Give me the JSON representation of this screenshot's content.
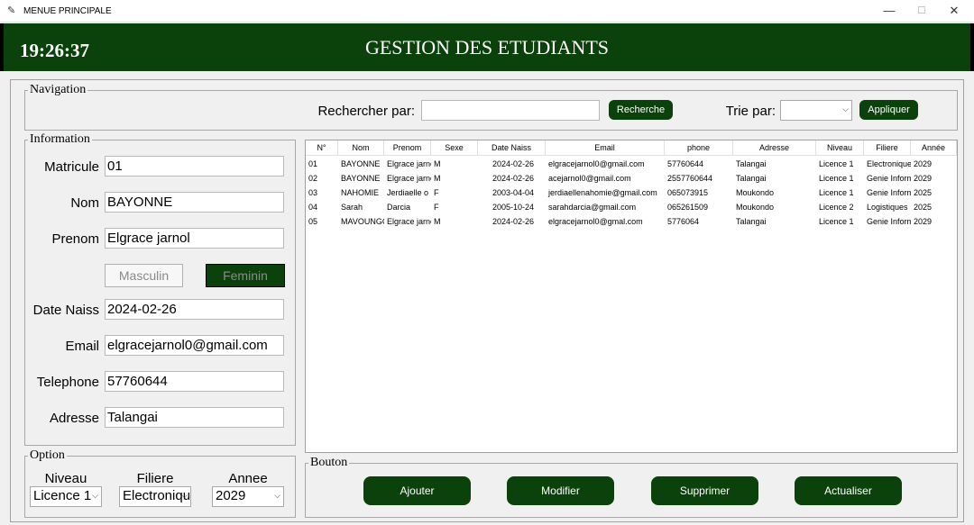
{
  "window": {
    "title": "MENUE PRINCIPALE",
    "min_glyph": "—",
    "max_glyph": "☐",
    "close_glyph": "✕"
  },
  "header": {
    "clock": "19:26:37",
    "title": "GESTION DES ETUDIANTS",
    "background": "#0b420b"
  },
  "navigation": {
    "frame_title": "Navigation",
    "search_label": "Rechercher par:",
    "search_value": "",
    "search_button": "Recherche",
    "sort_label": "Trie par:",
    "sort_value": "",
    "apply_button": "Appliquer"
  },
  "information": {
    "frame_title": "Information",
    "fields": [
      {
        "label": "Matricule",
        "value": "01"
      },
      {
        "label": "Nom",
        "value": "BAYONNE"
      },
      {
        "label": "Prenom",
        "value": "Elgrace jarnol"
      },
      {
        "label": "Date Naiss",
        "value": "2024-02-26"
      },
      {
        "label": "Email",
        "value": "elgracejarnol0@gmail.com"
      },
      {
        "label": "Telephone",
        "value": "57760644"
      },
      {
        "label": "Adresse",
        "value": "Talangai"
      }
    ],
    "gender": {
      "male": "Masculin",
      "female": "Feminin",
      "selected": "Feminin"
    }
  },
  "option": {
    "frame_title": "Option",
    "niveau_label": "Niveau",
    "niveau_value": "Licence 1",
    "filiere_label": "Filiere",
    "filiere_value": "Electronique",
    "annee_label": "Annee",
    "annee_value": "2029"
  },
  "table": {
    "columns": [
      "N°",
      "Nom",
      "Prenom",
      "Sexe",
      "Date Naiss",
      "Email",
      "phone",
      "Adresse",
      "Niveau",
      "Filiere",
      "Année"
    ],
    "rows": [
      [
        "01",
        "BAYONNE",
        "Elgrace jarnol",
        "M",
        "2024-02-26",
        "elgracejarnol0@gmail.com",
        "57760644",
        "Talangai",
        "Licence 1",
        "Electronique",
        "2029"
      ],
      [
        "02",
        "BAYONNE",
        "Elgrace jarnol",
        "M",
        "2024-02-26",
        "acejarnol0@gmail.com",
        "2557760644",
        "Talangai",
        "Licence 1",
        "Genie Informatique",
        "2029"
      ],
      [
        "03",
        "NAHOMIE",
        "Jerdiaelle o",
        "F",
        "2003-04-04",
        "jerdiaellenahomie@gmail.com",
        "065073915",
        "Moukondo",
        "Licence 1",
        "Genie Informatique",
        "2025"
      ],
      [
        "04",
        "Sarah",
        "Darcia",
        "F",
        "2005-10-24",
        "sarahdarcia@gmail.com",
        "065261509",
        "Moukondo",
        "Licence 2",
        "Logistiques",
        "2025"
      ],
      [
        "05",
        "MAVOUNGOU",
        "Elgrace jarnol",
        "M",
        "2024-02-26",
        "elgracejarnol0@gmal.com",
        "5776064",
        "Talangai",
        "Licence 1",
        "Genie Informatique",
        "2029"
      ]
    ]
  },
  "buttons": {
    "frame_title": "Bouton",
    "ajouter": "Ajouter",
    "modifier": "Modifier",
    "supprimer": "Supprimer",
    "actualiser": "Actualiser"
  },
  "colors": {
    "accent": "#0b420b",
    "disabled_text": "#8a8a8a"
  }
}
